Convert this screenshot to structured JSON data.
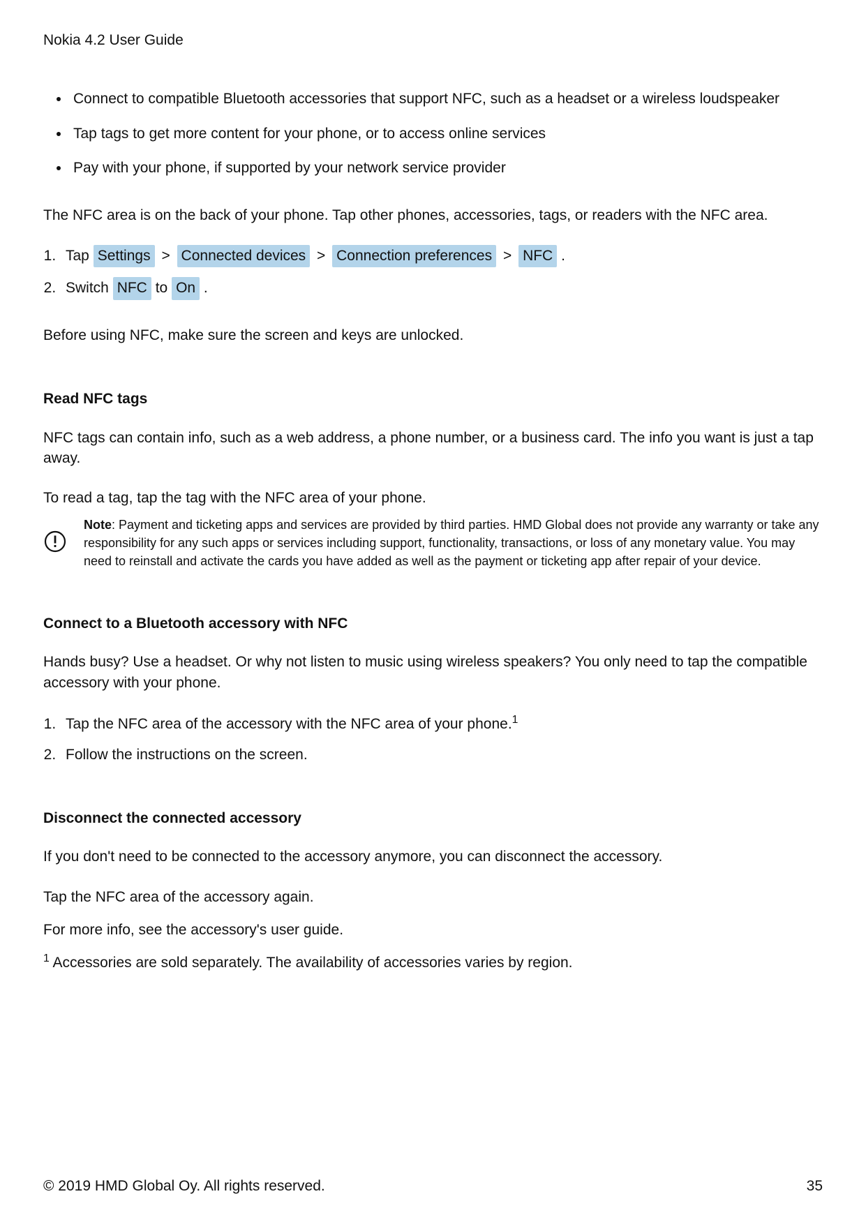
{
  "header": {
    "title": "Nokia 4.2 User Guide"
  },
  "intro_bullets": [
    "Connect to compatible Bluetooth accessories that support NFC, such as a headset or a wireless loudspeaker",
    "Tap tags to get more content for your phone, or to access online services",
    "Pay with your phone, if supported by your network service provider"
  ],
  "nfc_area_para": "The NFC area is on the back of your phone. Tap other phones, accessories, tags, or readers with the NFC area.",
  "steps1": {
    "item1": {
      "prefix": "Tap ",
      "path": [
        "Settings",
        "Connected devices",
        "Connection preferences",
        "NFC"
      ],
      "suffix": "."
    },
    "item2": {
      "prefix": "Switch ",
      "chip1": "NFC",
      "mid": " to ",
      "chip2": "On",
      "suffix": "."
    }
  },
  "before_using": "Before using NFC, make sure the screen and keys are unlocked.",
  "read_tags": {
    "title": "Read NFC tags",
    "para1": "NFC tags can contain info, such as a web address, a phone number, or a business card. The info you want is just a tap away.",
    "para2": "To read a tag, tap the tag with the NFC area of your phone."
  },
  "note": {
    "label": "Note",
    "text": ": Payment and ticketing apps and services are provided by third parties. HMD Global does not provide any warranty or take any responsibility for any such apps or services including support, functionality, transactions, or loss of any monetary value. You may need to reinstall and activate the cards you have added as well as the payment or ticketing app after repair of your device."
  },
  "connect_bt": {
    "title": "Connect to a Bluetooth accessory with NFC",
    "para": "Hands busy? Use a headset. Or why not listen to music using wireless speakers? You only need to tap the compatible accessory with your phone.",
    "steps": [
      "Tap the NFC area of the accessory with the NFC area of your phone.",
      "Follow the instructions on the screen."
    ],
    "footnote_ref": "1"
  },
  "disconnect": {
    "title": "Disconnect the connected accessory",
    "para1": "If you don't need to be connected to the accessory anymore, you can disconnect the accessory.",
    "para2": "Tap the NFC area of the accessory again.",
    "para3": "For more info, see the accessory's user guide."
  },
  "footnote": {
    "ref": "1",
    "text": " Accessories are sold separately. The availability of accessories varies by region."
  },
  "footer": {
    "copyright": "© 2019 HMD Global Oy. All rights reserved.",
    "page": "35"
  }
}
